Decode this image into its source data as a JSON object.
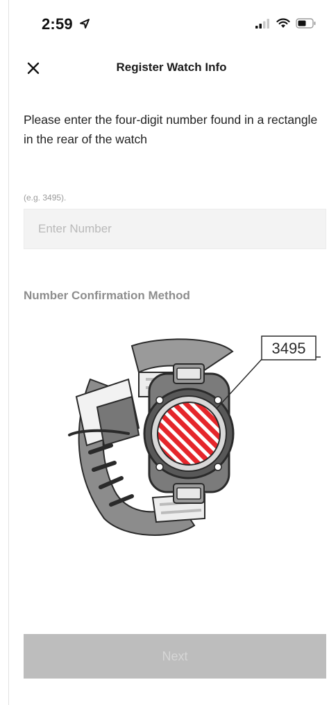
{
  "status_bar": {
    "time": "2:59",
    "location_icon": "location-arrow-icon",
    "signal_icon": "cellular-signal-icon",
    "wifi_icon": "wifi-icon",
    "battery_icon": "battery-icon"
  },
  "nav": {
    "close_icon": "close-icon",
    "title": "Register Watch Info"
  },
  "instruction": "Please enter the four-digit number found in a rectangle in the rear of the watch",
  "example_label": "(e.g. 3495).",
  "number_input": {
    "placeholder": "Enter Number",
    "value": ""
  },
  "confirmation": {
    "title": "Number Confirmation Method",
    "callout_number": "3495"
  },
  "next_button": {
    "label": "Next",
    "state": "disabled"
  },
  "colors": {
    "text_primary": "#1b1b1b",
    "text_muted": "#8d8d8d",
    "input_bg": "#f3f3f3",
    "button_disabled_bg": "#bdbdbd",
    "button_disabled_text": "#d6d6d6",
    "dial_stripe_red": "#e5262b",
    "illustration_gray": "#8a8a8a"
  }
}
